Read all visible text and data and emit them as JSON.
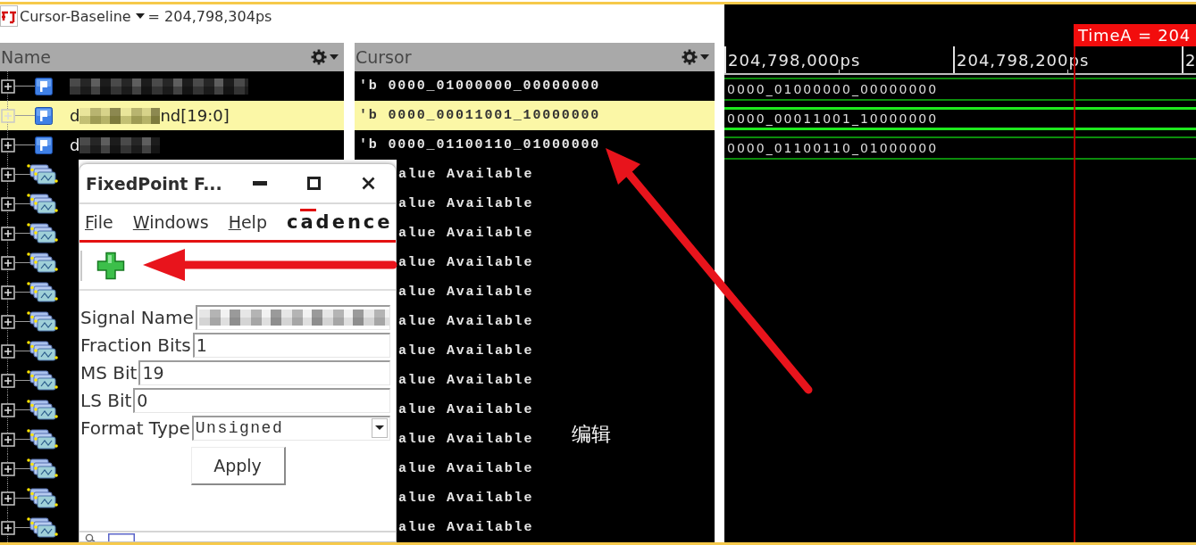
{
  "toolbar": {
    "cursor_label": "Cursor-Baseline",
    "cursor_value": "= 204,798,304ps"
  },
  "columns": [
    {
      "title": "Name"
    },
    {
      "title": "Cursor"
    }
  ],
  "signals": [
    {
      "kind": "bus",
      "selected": false,
      "expanded": false,
      "name": [
        {
          "kind": "redacted"
        }
      ],
      "cursor_value": "'b 0000_01000000_00000000",
      "wave_value": "0000_01000000_00000000"
    },
    {
      "kind": "bus",
      "selected": true,
      "expanded": false,
      "name": [
        {
          "kind": "text",
          "text": "d"
        },
        {
          "kind": "redacted"
        },
        {
          "kind": "text",
          "text": "nd[19:0]"
        }
      ],
      "cursor_value": "'b 0000_00011001_10000000",
      "wave_value": "0000_00011001_10000000"
    },
    {
      "kind": "bus",
      "selected": false,
      "expanded": false,
      "name": [
        {
          "kind": "text",
          "text": "d"
        },
        {
          "kind": "redacted"
        }
      ],
      "cursor_value": "'b 0000_01100110_01000000",
      "wave_value": "0000_01100110_01000000"
    },
    {
      "kind": "group",
      "selected": false,
      "expanded": false,
      "cursor_value": "alue Available"
    },
    {
      "kind": "group",
      "selected": false,
      "expanded": false,
      "cursor_value": "alue Available"
    },
    {
      "kind": "group",
      "selected": false,
      "expanded": false,
      "cursor_value": "alue Available"
    },
    {
      "kind": "group",
      "selected": false,
      "expanded": false,
      "cursor_value": "alue Available"
    },
    {
      "kind": "group",
      "selected": false,
      "expanded": false,
      "cursor_value": "alue Available"
    },
    {
      "kind": "group",
      "selected": false,
      "expanded": false,
      "cursor_value": "alue Available"
    },
    {
      "kind": "group",
      "selected": false,
      "expanded": false,
      "cursor_value": "alue Available"
    },
    {
      "kind": "group",
      "selected": false,
      "expanded": false,
      "cursor_value": "alue Available"
    },
    {
      "kind": "group",
      "selected": false,
      "expanded": false,
      "cursor_value": "alue Available"
    },
    {
      "kind": "group",
      "selected": false,
      "expanded": false,
      "cursor_value": "alue Available"
    },
    {
      "kind": "group",
      "selected": false,
      "expanded": false,
      "cursor_value": "alue Available"
    },
    {
      "kind": "group",
      "selected": false,
      "expanded": false,
      "cursor_value": "alue Available"
    },
    {
      "kind": "group",
      "selected": false,
      "expanded": false,
      "cursor_value": "alue Available"
    }
  ],
  "waveform": {
    "cursor_flag": "TimeA = 204",
    "ruler_labels": [
      "204,798,000ps",
      "204,798,200ps",
      "2"
    ]
  },
  "dialog": {
    "title": "FixedPoint F...",
    "menu": [
      "File",
      "Windows",
      "Help"
    ],
    "logo": "cadence",
    "fields": [
      {
        "kind": "redacted",
        "label": "Signal Name"
      },
      {
        "kind": "text",
        "label": "Fraction Bits",
        "value": "1"
      },
      {
        "kind": "text",
        "label": "MS Bit",
        "value": "19"
      },
      {
        "kind": "text",
        "label": "LS Bit",
        "value": "0"
      },
      {
        "kind": "dropdown",
        "label": "Format Type",
        "value": "Unsigned"
      }
    ],
    "button": "Apply"
  },
  "annotation": "编辑"
}
